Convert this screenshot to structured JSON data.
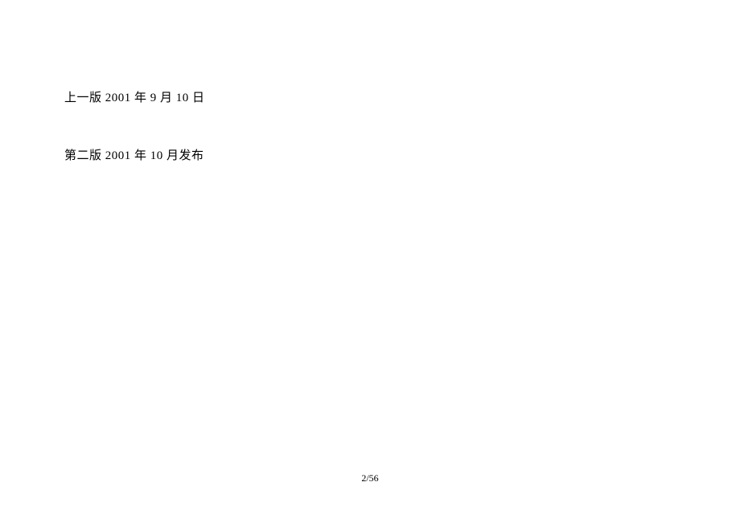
{
  "content": {
    "line1": "上一版 2001 年 9 月 10 日",
    "line2": "第二版 2001 年 10 月发布"
  },
  "footer": {
    "page_number": "2/56"
  }
}
